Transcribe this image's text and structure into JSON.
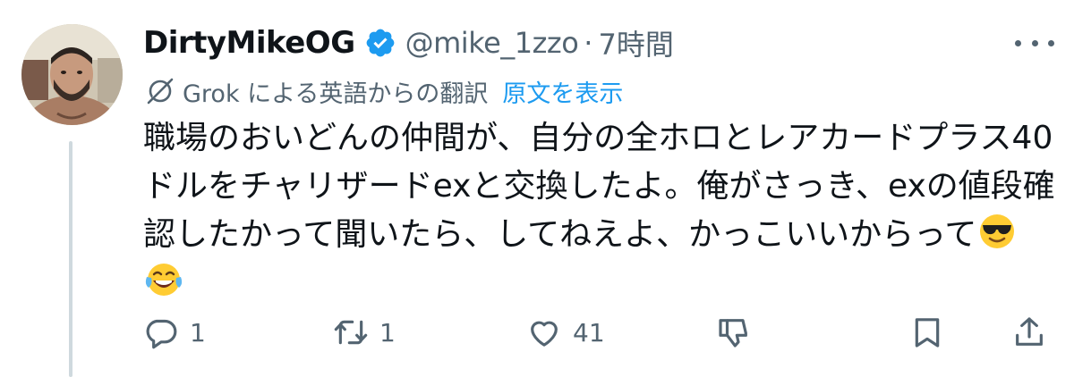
{
  "user": {
    "display_name": "DirtyMikeOG",
    "handle": "@mike_1zzo",
    "separator": "·",
    "time": "7時間"
  },
  "translation": {
    "label": "Grok による英語からの翻訳",
    "show_original": "原文を表示"
  },
  "tweet": {
    "lines": [
      "職場のおいどんの仲間が、自分の全ホロとレアカードプラス40",
      "ドルをチャリザードexと交換したよ。俺がさっき、exの値段確",
      "認したかって聞いたら、してねえよ、かっこいいからって"
    ],
    "emoji_1": "smiling-face-with-sunglasses",
    "emoji_2": "face-with-tears-of-joy"
  },
  "actions": {
    "reply_count": "1",
    "retweet_count": "1",
    "like_count": "41"
  },
  "colors": {
    "text": "#0f1419",
    "secondary": "#536471",
    "accent": "#1d9bf0",
    "thread_line": "#cfd9de"
  }
}
